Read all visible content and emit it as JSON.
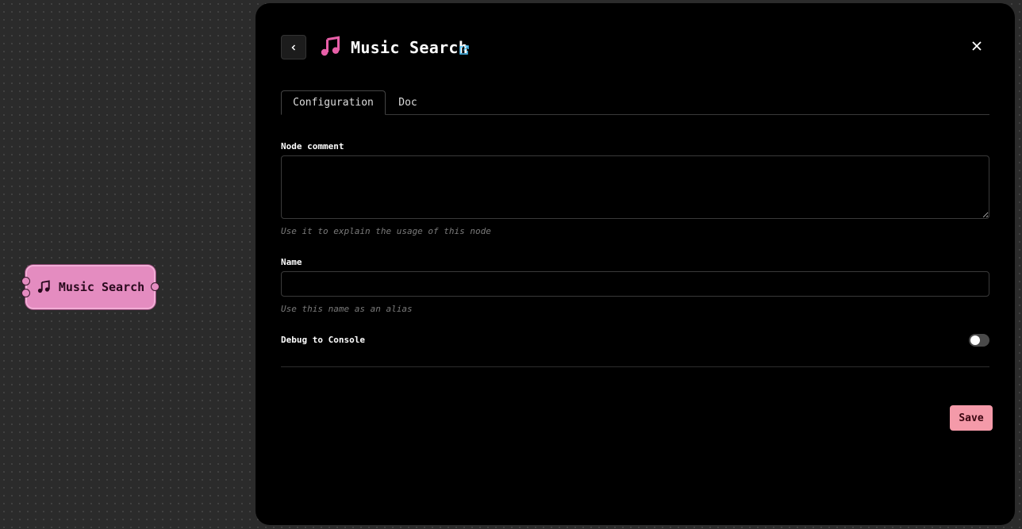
{
  "canvas": {
    "node": {
      "label": "Music Search",
      "icon": "music-note-icon",
      "color": "#e48cc0"
    }
  },
  "panel": {
    "title": "Music Search",
    "title_icon": "music-note-icon",
    "accent": "#e85fa8",
    "tabs": [
      {
        "label": "Configuration",
        "active": true
      },
      {
        "label": "Doc",
        "active": false
      }
    ],
    "fields": {
      "node_comment": {
        "label": "Node comment",
        "value": "",
        "hint": "Use it to explain the usage of this node"
      },
      "name": {
        "label": "Name",
        "value": "",
        "hint": "Use this name as an alias"
      },
      "debug": {
        "label": "Debug to Console",
        "enabled": false
      }
    },
    "save_label": "Save",
    "save_color": "#f49aa9"
  }
}
